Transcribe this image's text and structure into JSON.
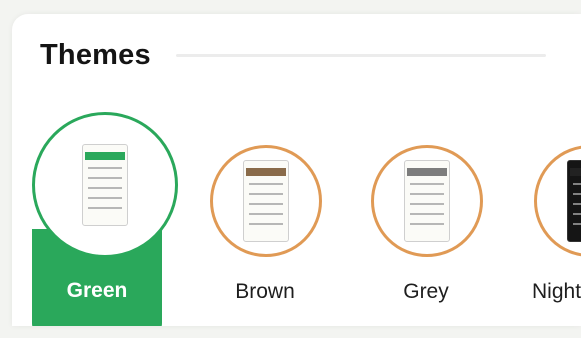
{
  "section": {
    "title": "Themes"
  },
  "themes": [
    {
      "label": "Green",
      "selected": true,
      "accent": "#2aa85b"
    },
    {
      "label": "Brown",
      "selected": false,
      "accent": "#8a6b4a"
    },
    {
      "label": "Grey",
      "selected": false,
      "accent": "#7d7d7d"
    },
    {
      "label": "Night",
      "selected": false,
      "accent": "#222222"
    }
  ],
  "colors": {
    "selected_bg": "#2aa85b",
    "ring": "#e09a55",
    "title": "#141414"
  }
}
